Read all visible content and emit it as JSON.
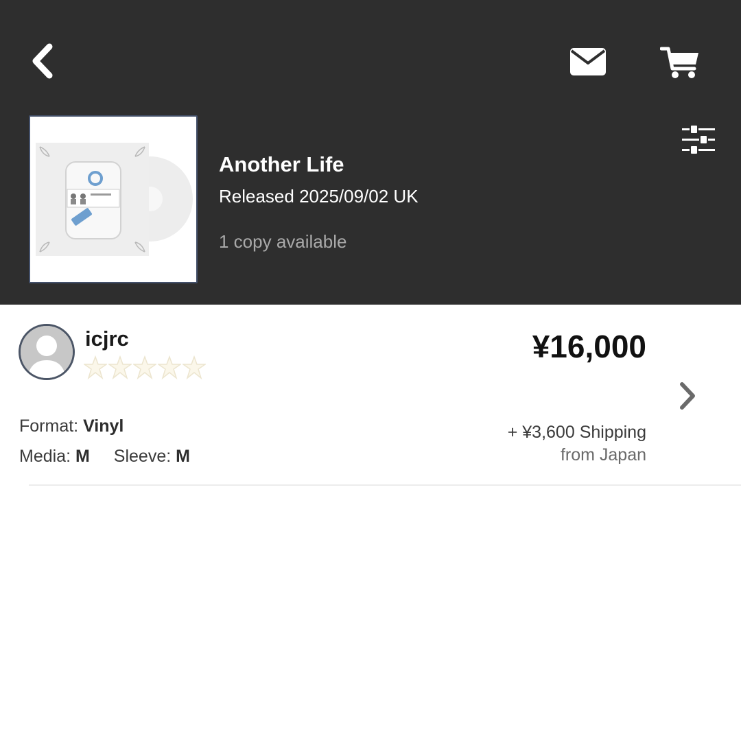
{
  "header": {
    "back_icon": "chevron-left-icon",
    "mail_icon": "envelope-icon",
    "cart_icon": "shopping-cart-icon",
    "filter_icon": "sliders-icon",
    "background_color": "#2e2e2e"
  },
  "release": {
    "title": "Another Life",
    "info": "Released 2025/09/02 UK",
    "availability": "1 copy available",
    "cover_icon": "album-cover-image"
  },
  "listing": {
    "seller": "icjrc",
    "avatar_icon": "user-avatar-icon",
    "rating": 0,
    "rating_max": 5,
    "price": "¥16,000",
    "format_label": "Format:",
    "format_value": "Vinyl",
    "media_label": "Media:",
    "media_value": "M",
    "sleeve_label": "Sleeve:",
    "sleeve_value": "M",
    "shipping": "+ ¥3,600 Shipping",
    "origin": "from Japan",
    "chevron_icon": "chevron-right-icon"
  }
}
